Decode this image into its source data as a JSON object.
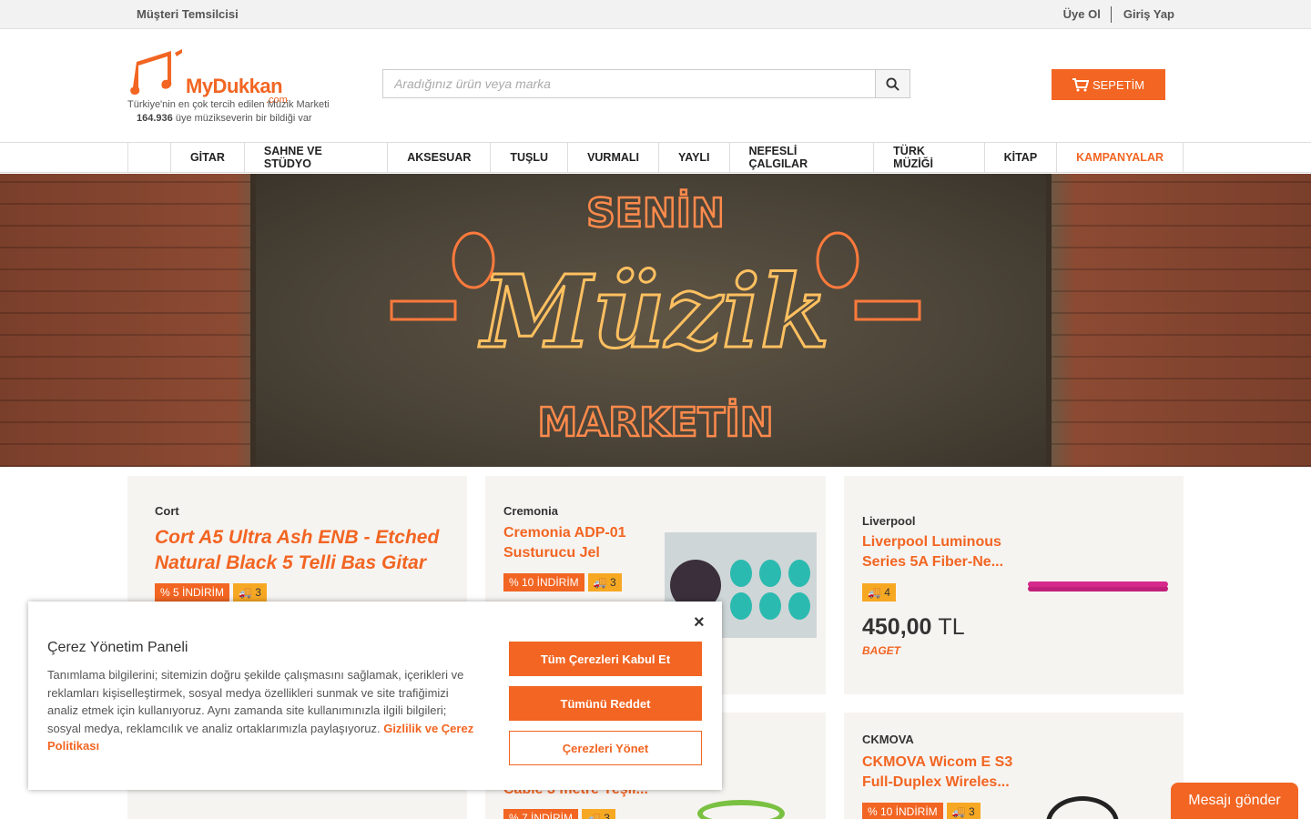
{
  "topbar": {
    "support": "Müşteri Temsilcisi",
    "register": "Üye Ol",
    "login": "Giriş Yap"
  },
  "header": {
    "logo_text": "MyDukkan",
    "logo_com": ".com",
    "tagline": "Türkiye'nin en çok tercih edilen Müzik Marketi",
    "member_count": "164.936",
    "member_text": " üye müzikseverin bir bildiği var",
    "search_placeholder": "Aradığınız ürün veya marka",
    "cart_label": "SEPETİM"
  },
  "nav": {
    "home_icon": "",
    "items": [
      "GİTAR",
      "SAHNE VE STÜDYO",
      "AKSESUAR",
      "TUŞLU",
      "VURMALI",
      "YAYLI",
      "NEFESLİ ÇALGILAR",
      "TÜRK MÜZİĞİ",
      "KİTAP"
    ],
    "campaign": "KAMPANYALAR"
  },
  "hero": {
    "neon_top": "SENİN",
    "neon_main": "Müzik",
    "neon_bottom": "MARKETİN",
    "prev": "‹",
    "next": "›"
  },
  "products": [
    {
      "brand": "Cort",
      "title_line1": "Cort A5 Ultra Ash ENB - Etched",
      "title_line2": "Natural Black 5 Telli Bas Gitar",
      "discount": "% 5 İNDİRİM",
      "ship": "3"
    },
    {
      "brand": "Cremonia",
      "title_line1": "Cremonia ADP-01",
      "title_line2": "Susturucu Jel",
      "discount": "% 10 İNDİRİM",
      "ship": "3"
    },
    {
      "brand": "Liverpool",
      "title_line1": "Liverpool Luminous",
      "title_line2": "Series 5A Fiber-Ne...",
      "ship": "4",
      "price": "450,00",
      "currency": "TL",
      "category": "BAGET"
    },
    {
      "title_partial": "Cable 3 metre Yeşil...",
      "discount": "% 7 İNDİRİM",
      "ship": "3"
    },
    {
      "brand": "CKMOVA",
      "title_line1": "CKMOVA Wicom E S3",
      "title_line2": "Full-Duplex Wireles...",
      "discount": "% 10 İNDİRİM",
      "ship": "3"
    }
  ],
  "cookie": {
    "title": "Çerez Yönetim Paneli",
    "body": "Tanımlama bilgilerini; sitemizin doğru şekilde çalışmasını sağlamak, içerikleri ve reklamları kişiselleştirmek, sosyal medya özellikleri sunmak ve site trafiğimizi analiz etmek için kullanıyoruz. Aynı zamanda site kullanımınızla ilgili bilgileri; sosyal medya, reklamcılık ve analiz ortaklarımızla paylaşıyoruz.",
    "policy_link": "Gizlilik ve Çerez Politikası",
    "accept_all": "Tüm Çerezleri Kabul Et",
    "reject_all": "Tümünü Reddet",
    "manage": "Çerezleri Yönet",
    "close": "×"
  },
  "chat": {
    "label": "Mesajı gönder"
  },
  "colors": {
    "accent": "#f26522",
    "ship": "#f7a823"
  }
}
